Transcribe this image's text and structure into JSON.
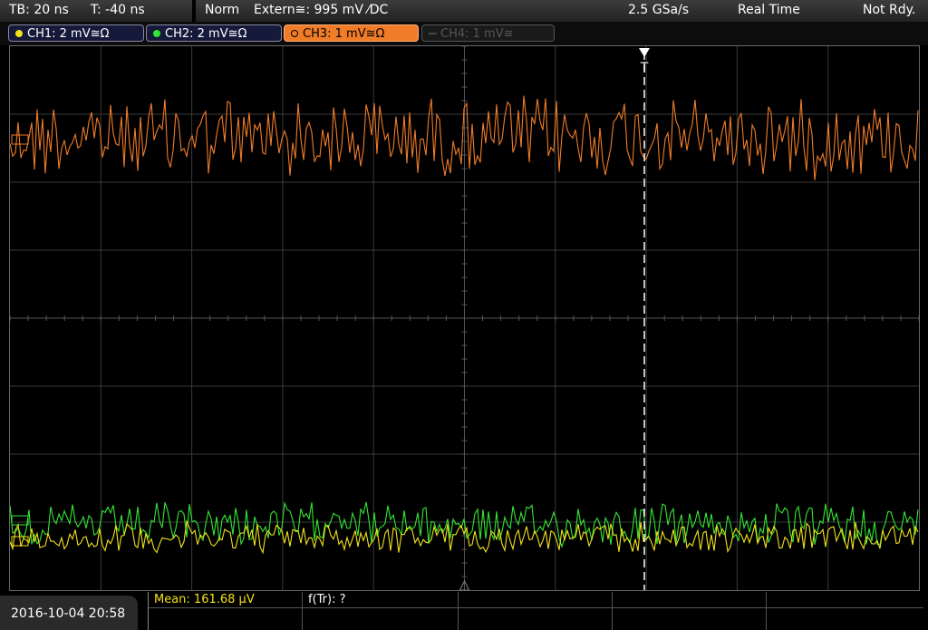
{
  "status_bar": {
    "timebase": "TB: 20 ns",
    "trigger_time": "T: -40 ns",
    "mode": "Norm",
    "trigger_source": "Extern≅: 995 mV ⁄DC",
    "sample_rate": "2.5 GSa/s",
    "acq_mode": "Real Time",
    "status": "Not Rdy."
  },
  "channels": [
    {
      "id": "ch1",
      "label": "CH1: 2 mV≅Ω",
      "color": "#f2e21a",
      "active": false,
      "enabled": true
    },
    {
      "id": "ch2",
      "label": "CH2: 2 mV≅Ω",
      "color": "#33e633",
      "active": false,
      "enabled": true
    },
    {
      "id": "ch3",
      "label": "CH3: 1 mV≅Ω",
      "color": "#f07c28",
      "active": true,
      "enabled": true
    },
    {
      "id": "ch4",
      "label": "CH4: 1 mV≅",
      "color": "#666666",
      "active": false,
      "enabled": false
    }
  ],
  "trigger_marker": "T",
  "footer": {
    "datetime": "2016-10-04 20:58",
    "mean_label": "Mean: 161.68 µV",
    "ftr_label": "f(Tr): ?"
  },
  "colors": {
    "grid": "#3a3a3a",
    "mean_text": "#f2e21a",
    "ch3_trace": "#f07c28",
    "ch2_trace": "#33e633",
    "ch1_trace": "#f2e21a"
  }
}
